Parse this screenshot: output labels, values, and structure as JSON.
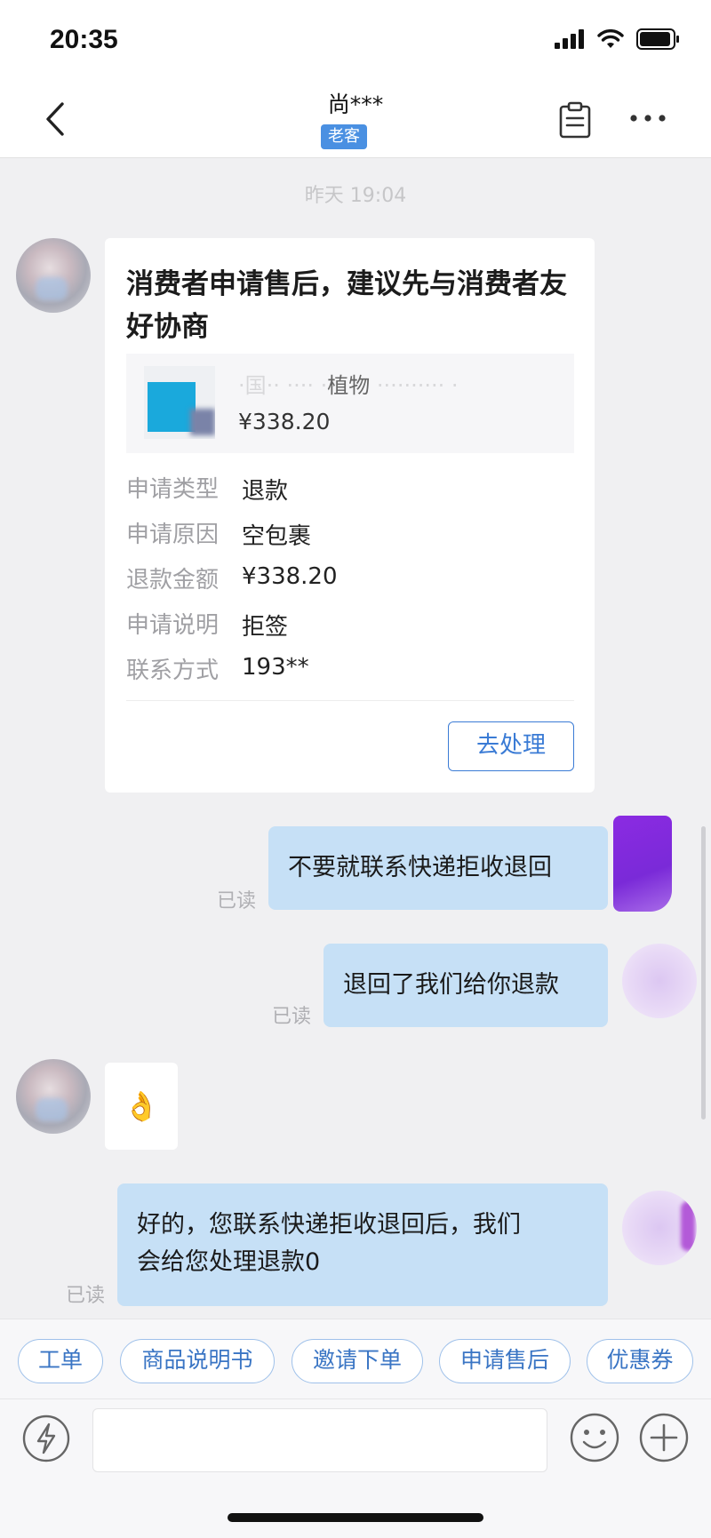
{
  "status_bar": {
    "time": "20:35"
  },
  "header": {
    "title": "尚***",
    "badge": "老客"
  },
  "chat": {
    "timestamp": "昨天 19:04",
    "card": {
      "title": "消费者申请售后，建议先与消费者友好协商",
      "product_name": "植物",
      "product_price": "¥338.20",
      "rows": [
        {
          "label": "申请类型",
          "value": "退款"
        },
        {
          "label": "申请原因",
          "value": "空包裹"
        },
        {
          "label": "退款金额",
          "value": "¥338.20"
        },
        {
          "label": "申请说明",
          "value": "拒签"
        },
        {
          "label": "联系方式",
          "value": "193**"
        }
      ],
      "action_label": "去处理"
    },
    "messages": [
      {
        "text": "不要就联系快递拒收退回",
        "status": "已读"
      },
      {
        "text": "退回了我们给你退款",
        "status": "已读"
      },
      {
        "emoji": "👌"
      },
      {
        "line1": "好的，您联系快递拒收退回后，我们",
        "line2": "会给您处理退款0",
        "status": "已读"
      }
    ]
  },
  "quick_replies": [
    "工单",
    "商品说明书",
    "邀请下单",
    "申请售后",
    "优惠券"
  ],
  "icons": {
    "back": "chevron-left-icon",
    "order": "clipboard-icon",
    "more": "more-dots-icon",
    "quick": "lightning-icon",
    "emoji": "smiley-icon",
    "add": "plus-icon"
  },
  "colors": {
    "accent": "#3a7bd5",
    "bubble_out": "#c6e0f6",
    "badge": "#4a90e2",
    "background": "#f0f0f2"
  }
}
